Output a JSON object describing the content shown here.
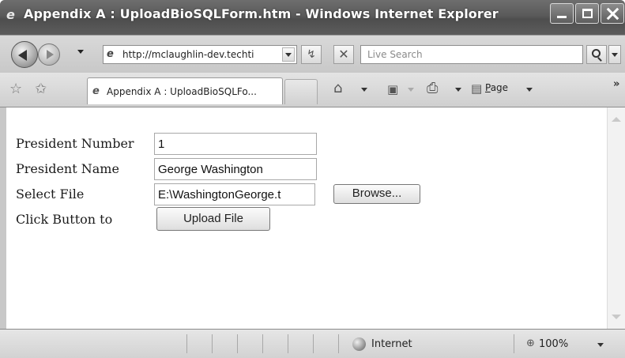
{
  "window": {
    "title": "Appendix A : UploadBioSQLForm.htm - Windows Internet Explorer",
    "title_icon": "ie-logo-icon"
  },
  "toolbar": {
    "address": "http://mclaughlin-dev.techti",
    "search_placeholder": "Live Search",
    "refresh_glyph": "⁴⁄₇",
    "stop_glyph": "✕"
  },
  "tabs": [
    {
      "label": "Appendix A : UploadBioSQLFo...",
      "active": true
    }
  ],
  "commands": {
    "page_label_first": "P",
    "page_label_rest": "age",
    "chevrons": "»"
  },
  "form": {
    "rows": [
      {
        "label": "President Number",
        "value": "1"
      },
      {
        "label": "President Name",
        "value": "George Washington"
      },
      {
        "label": "Select File",
        "value": "E:\\WashingtonGeorge.t"
      },
      {
        "label": "Click Button to"
      }
    ],
    "browse_label": "Browse...",
    "upload_label": "Upload File"
  },
  "statusbar": {
    "zone": "Internet",
    "zoom": "100%"
  },
  "colors": {
    "titlebar": "#5a5a5a",
    "toolbar": "#d0d0d0",
    "content": "#ffffff"
  }
}
